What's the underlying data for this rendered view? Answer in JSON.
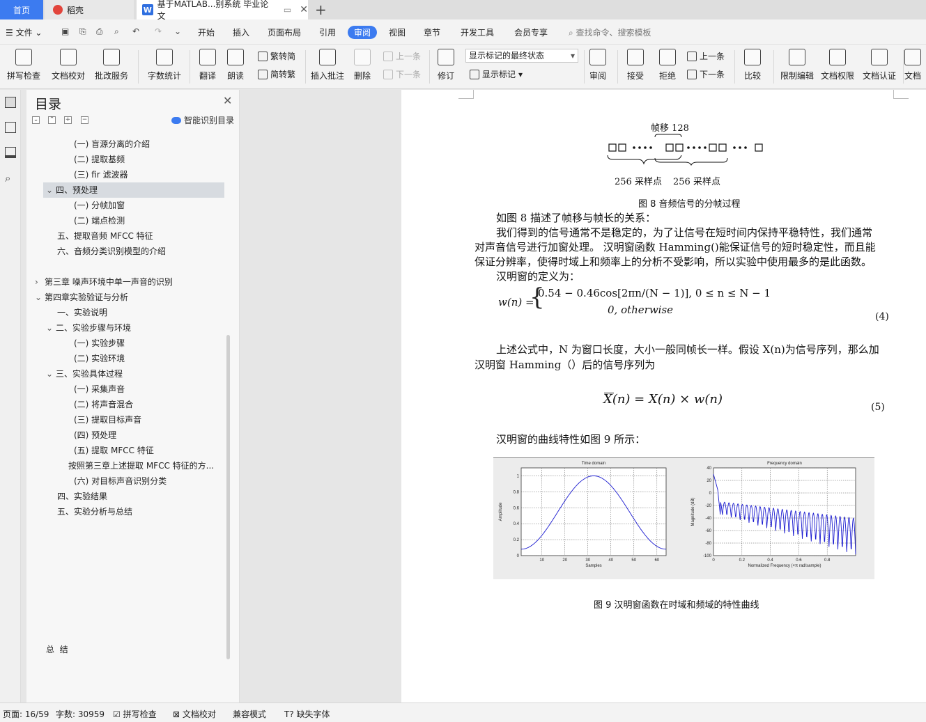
{
  "tabs": {
    "home": "首页",
    "daoke": "稻壳",
    "doc": "基于MATLAB...别系统 毕业论文"
  },
  "menu": {
    "file": "文件",
    "items": [
      "开始",
      "插入",
      "页面布局",
      "引用",
      "审阅",
      "视图",
      "章节",
      "开发工具",
      "会员专享"
    ],
    "search": "查找命令、搜索模板"
  },
  "ribbon": {
    "spell": "拼写检查",
    "proof": "文档校对",
    "batch": "批改服务",
    "wordcount": "字数统计",
    "translate": "翻译",
    "read": "朗读",
    "trad": "繁转简",
    "simp": "简转繁",
    "insert_comment": "插入批注",
    "delete": "删除",
    "prev": "上一条",
    "next": "下一条",
    "track": "修订",
    "markup_select": "显示标记的最终状态",
    "show_markup": "显示标记",
    "review_pane": "审阅",
    "accept": "接受",
    "reject": "拒绝",
    "prev2": "上一条",
    "next2": "下一条",
    "compare": "比较",
    "restrict": "限制编辑",
    "permission": "文档权限",
    "certify": "文档认证",
    "more": "文档"
  },
  "toc": {
    "title": "目录",
    "smart": "智能识别目录",
    "items": [
      "(一) 盲源分离的介绍",
      "(二) 提取基频",
      "(三) fir 滤波器",
      "四、预处理",
      "(一) 分帧加窗",
      "(二) 端点检测",
      "五、提取音频 MFCC 特征",
      "六、音频分类识别模型的介绍",
      "第三章 噪声环境中单一声音的识别",
      "第四章实验验证与分析",
      "一、实验说明",
      "二、实验步骤与环境",
      "(一) 实验步骤",
      "(二) 实验环境",
      "三、实验具体过程",
      "(一) 采集声音",
      "(二) 将声音混合",
      "(三) 提取目标声音",
      "(四) 预处理",
      "(五) 提取 MFCC 特征",
      "按照第三章上述提取 MFCC 特征的方...",
      "(六) 对目标声音识别分类",
      "四、实验结果",
      "五、实验分析与总结",
      "总  结"
    ]
  },
  "doc": {
    "fig8": {
      "shift": "帧移 128",
      "samples1": "256 采样点",
      "samples2": "256 采样点",
      "caption": "图 8  音频信号的分帧过程"
    },
    "p1": "如图 8 描述了帧移与帧长的关系：",
    "p2a": "我们得到的信号通常不是稳定的，为了让信号在短时间内保持平稳特性，我们通常",
    "p2b": "对声音信号进行加窗处理。 汉明窗函数 Hamming()能保证信号的短时稳定性，而且能",
    "p2c": "保证分辨率，使得时域上和频率上的分析不受影响，所以实验中使用最多的是此函数。",
    "p3": "汉明窗的定义为：",
    "eq4_lhs": "w(n) =",
    "eq4_l1": "0.54 − 0.46cos[2πn/(N − 1)], 0 ≤ n ≤ N − 1",
    "eq4_l2": "0, otherwise",
    "eq4_no": "(4)",
    "p4a": "上述公式中，N 为窗口长度，大小一般同帧长一样。假设 X(n)为信号序列，那么加",
    "p4b": "汉明窗 Hamming（）后的信号序列为",
    "eq5": "X(n) = X(n) × w(n)",
    "eq5_no": "(5)",
    "p5": "汉明窗的曲线特性如图 9 所示：",
    "fig9_caption": "图 9  汉明窗函数在时域和频域的特性曲线"
  },
  "chart_data": [
    {
      "type": "line",
      "title": "Time domain",
      "xlabel": "Samples",
      "ylabel": "Amplitude",
      "xlim": [
        1,
        64
      ],
      "ylim": [
        0,
        1.1
      ],
      "xticks": [
        "10",
        "20",
        "30",
        "40",
        "50",
        "60"
      ],
      "yticks": [
        "0",
        "0.2",
        "0.4",
        "0.6",
        "0.8",
        "1"
      ],
      "grid": true,
      "series": [
        {
          "x": [
            1,
            8,
            16,
            24,
            32,
            40,
            48,
            56,
            64
          ],
          "values": [
            0.08,
            0.2,
            0.5,
            0.85,
            1.0,
            0.85,
            0.5,
            0.2,
            0.08
          ]
        }
      ]
    },
    {
      "type": "line",
      "title": "Frequency domain",
      "xlabel": "Normalized Frequency  (×π rad/sample)",
      "ylabel": "Magnitude (dB)",
      "xlim": [
        0,
        1
      ],
      "ylim": [
        -100,
        40
      ],
      "xticks": [
        "0",
        "0.2",
        "0.4",
        "0.6",
        "0.8"
      ],
      "yticks": [
        "40",
        "20",
        "0",
        "-20",
        "-40",
        "-60",
        "-80",
        "-100"
      ],
      "grid": true,
      "series": [
        {
          "x": [
            0,
            0.02,
            0.04,
            0.06,
            0.1,
            0.2,
            0.4,
            0.6,
            0.8,
            1.0
          ],
          "values": [
            30,
            20,
            0,
            -30,
            -15,
            -22,
            -28,
            -32,
            -34,
            -36
          ]
        }
      ]
    }
  ],
  "status": {
    "page": "页面: 16/59",
    "words": "字数: 30959",
    "spell": "拼写检查",
    "proof": "文档校对",
    "compat": "兼容模式",
    "font": "缺失字体"
  }
}
